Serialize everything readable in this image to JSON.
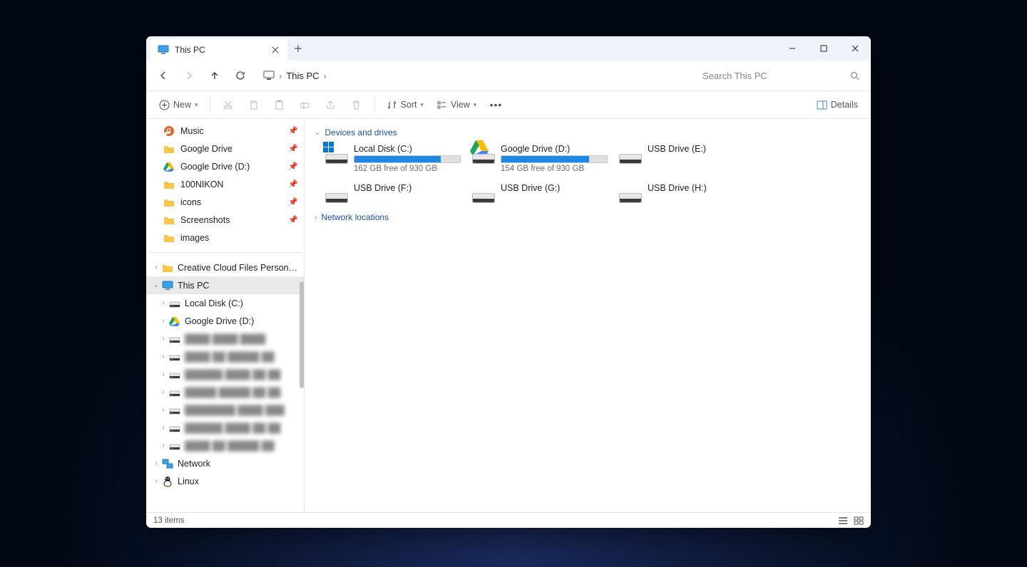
{
  "tab": {
    "title": "This PC"
  },
  "addr": {
    "location": "This PC"
  },
  "search": {
    "placeholder": "Search This PC"
  },
  "toolbar": {
    "new": "New",
    "sort": "Sort",
    "view": "View",
    "details": "Details"
  },
  "quick": [
    {
      "label": "Music",
      "icon": "music"
    },
    {
      "label": "Google Drive",
      "icon": "folder"
    },
    {
      "label": "Google Drive (D:)",
      "icon": "gdrive"
    },
    {
      "label": "100NIKON",
      "icon": "folder"
    },
    {
      "label": "icons",
      "icon": "folder"
    },
    {
      "label": "Screenshots",
      "icon": "folder"
    },
    {
      "label": "images",
      "icon": "folder",
      "nopin": true
    }
  ],
  "tree": {
    "ccf": "Creative Cloud Files Personal Account chris",
    "thispc": "This PC",
    "localdisk": "Local Disk (C:)",
    "gdrive": "Google Drive (D:)",
    "network": "Network",
    "linux": "Linux"
  },
  "groups": {
    "devices": "Devices and drives",
    "network": "Network locations"
  },
  "drives": [
    {
      "name": "Local Disk (C:)",
      "free": "162 GB free of 930 GB",
      "pct": 82,
      "kind": "windisk"
    },
    {
      "name": "Google Drive (D:)",
      "free": "154 GB free of 930 GB",
      "pct": 83,
      "kind": "gdrive"
    },
    {
      "name": "USB Drive (E:)",
      "kind": "usb"
    },
    {
      "name": "USB Drive (F:)",
      "kind": "usb"
    },
    {
      "name": "USB Drive (G:)",
      "kind": "usb"
    },
    {
      "name": "USB Drive (H:)",
      "kind": "usb"
    }
  ],
  "status": {
    "text": "13 items"
  }
}
